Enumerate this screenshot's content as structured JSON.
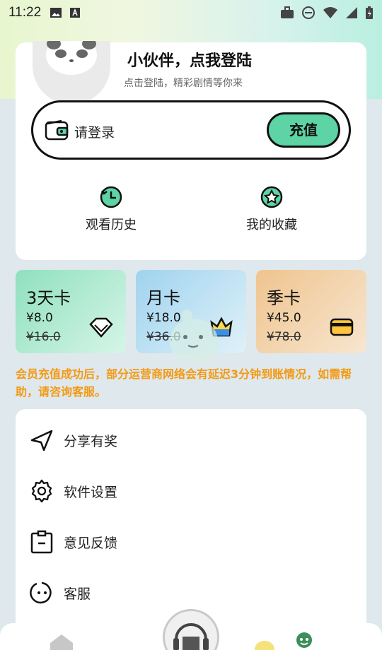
{
  "status_bar": {
    "time": "11:22"
  },
  "profile": {
    "title": "小伙伴，点我登陆",
    "subtitle": "点击登陆，精彩剧情等你来"
  },
  "wallet": {
    "login_text": "请登录",
    "recharge_label": "充值"
  },
  "quick_actions": [
    {
      "label": "观看历史",
      "icon": "history-icon"
    },
    {
      "label": "我的收藏",
      "icon": "star-icon"
    }
  ],
  "membership_cards": [
    {
      "title": "3天卡",
      "price": "¥8.0",
      "original_price": "¥16.0",
      "icon": "diamond-icon",
      "color": "#8fe0bd"
    },
    {
      "title": "月卡",
      "price": "¥18.0",
      "original_price": "¥36.0",
      "icon": "crown-icon",
      "color": "#9fd3ef"
    },
    {
      "title": "季卡",
      "price": "¥45.0",
      "original_price": "¥78.0",
      "icon": "card-icon",
      "color": "#efc48e"
    }
  ],
  "notice": "会员充值成功后，部分运营商网络会有延迟3分钟到账情况，如需帮助，请咨询客服。",
  "menu": [
    {
      "label": "分享有奖",
      "icon": "share-icon"
    },
    {
      "label": "软件设置",
      "icon": "gear-icon"
    },
    {
      "label": "意见反馈",
      "icon": "clipboard-icon"
    },
    {
      "label": "客服",
      "icon": "face-icon"
    }
  ],
  "colors": {
    "accent": "#5ed3a3",
    "notice": "#f39a14"
  }
}
